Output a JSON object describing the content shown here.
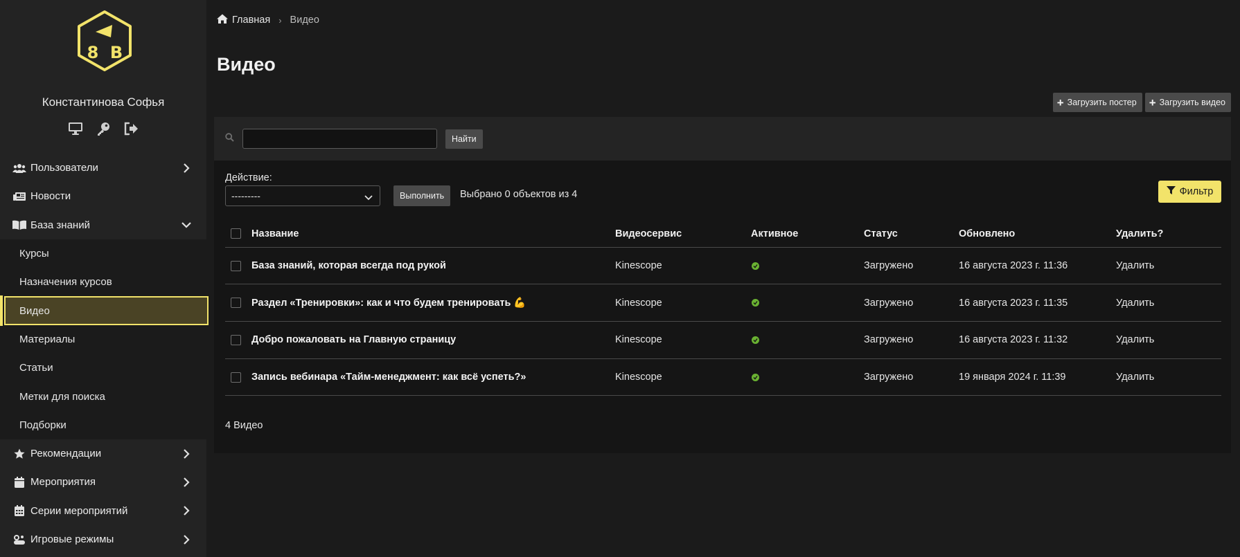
{
  "sidebar": {
    "user_name": "Константинова Софья",
    "user_actions": [
      "monitor-icon",
      "key-icon",
      "sign-out-icon"
    ],
    "items": [
      {
        "label": "Пользователи",
        "icon": "users-icon",
        "chevron": "right"
      },
      {
        "label": "Новости",
        "icon": "newspaper-icon",
        "chevron": null
      },
      {
        "label": "База знаний",
        "icon": "book-icon",
        "chevron": "down"
      }
    ],
    "subitems": [
      {
        "label": "Курсы"
      },
      {
        "label": "Назначения курсов"
      },
      {
        "label": "Видео",
        "active": true
      },
      {
        "label": "Материалы"
      },
      {
        "label": "Статьи"
      },
      {
        "label": "Метки для поиска"
      },
      {
        "label": "Подборки"
      }
    ],
    "items_after": [
      {
        "label": "Рекомендации",
        "icon": "star-icon",
        "chevron": "right"
      },
      {
        "label": "Мероприятия",
        "icon": "calendar-icon",
        "chevron": "right"
      },
      {
        "label": "Серии мероприятий",
        "icon": "calendar-grid-icon",
        "chevron": "right"
      },
      {
        "label": "Игровые режимы",
        "icon": "gamepad-icon",
        "chevron": "right"
      }
    ]
  },
  "breadcrumb": {
    "home": "Главная",
    "current": "Видео"
  },
  "page": {
    "title": "Видео"
  },
  "toolbar": {
    "upload_poster": "Загрузить постер",
    "upload_video": "Загрузить видео"
  },
  "search": {
    "value": "",
    "button": "Найти"
  },
  "actions": {
    "label": "Действие:",
    "selected": "---------",
    "run_button": "Выполнить",
    "selected_info": "Выбрано 0 объектов из 4",
    "filter_button": "Фильтр"
  },
  "table": {
    "headers": [
      "Название",
      "Видеосервис",
      "Активное",
      "Статус",
      "Обновлено",
      "Удалить?"
    ],
    "rows": [
      {
        "title": "База знаний, которая всегда под рукой",
        "service": "Kinescope",
        "active": true,
        "status": "Загружено",
        "updated": "16 августа 2023 г. 11:36",
        "delete": "Удалить"
      },
      {
        "title": "Раздел «Тренировки»: как и что будем тренировать 💪",
        "service": "Kinescope",
        "active": true,
        "status": "Загружено",
        "updated": "16 августа 2023 г. 11:35",
        "delete": "Удалить"
      },
      {
        "title": "Добро пожаловать на Главную страницу",
        "service": "Kinescope",
        "active": true,
        "status": "Загружено",
        "updated": "16 августа 2023 г. 11:32",
        "delete": "Удалить"
      },
      {
        "title": "Запись вебинара «Тайм-менеджмент: как всё успеть?»",
        "service": "Kinescope",
        "active": true,
        "status": "Загружено",
        "updated": "19 января 2024 г. 11:39",
        "delete": "Удалить"
      }
    ]
  },
  "footer": {
    "count": "4 Видео"
  },
  "colors": {
    "accent": "#f2e36a",
    "active_bg": "#4a4325",
    "success": "#6ab232",
    "sidebar_bg": "#232323",
    "page_bg": "#1b1b1b"
  }
}
